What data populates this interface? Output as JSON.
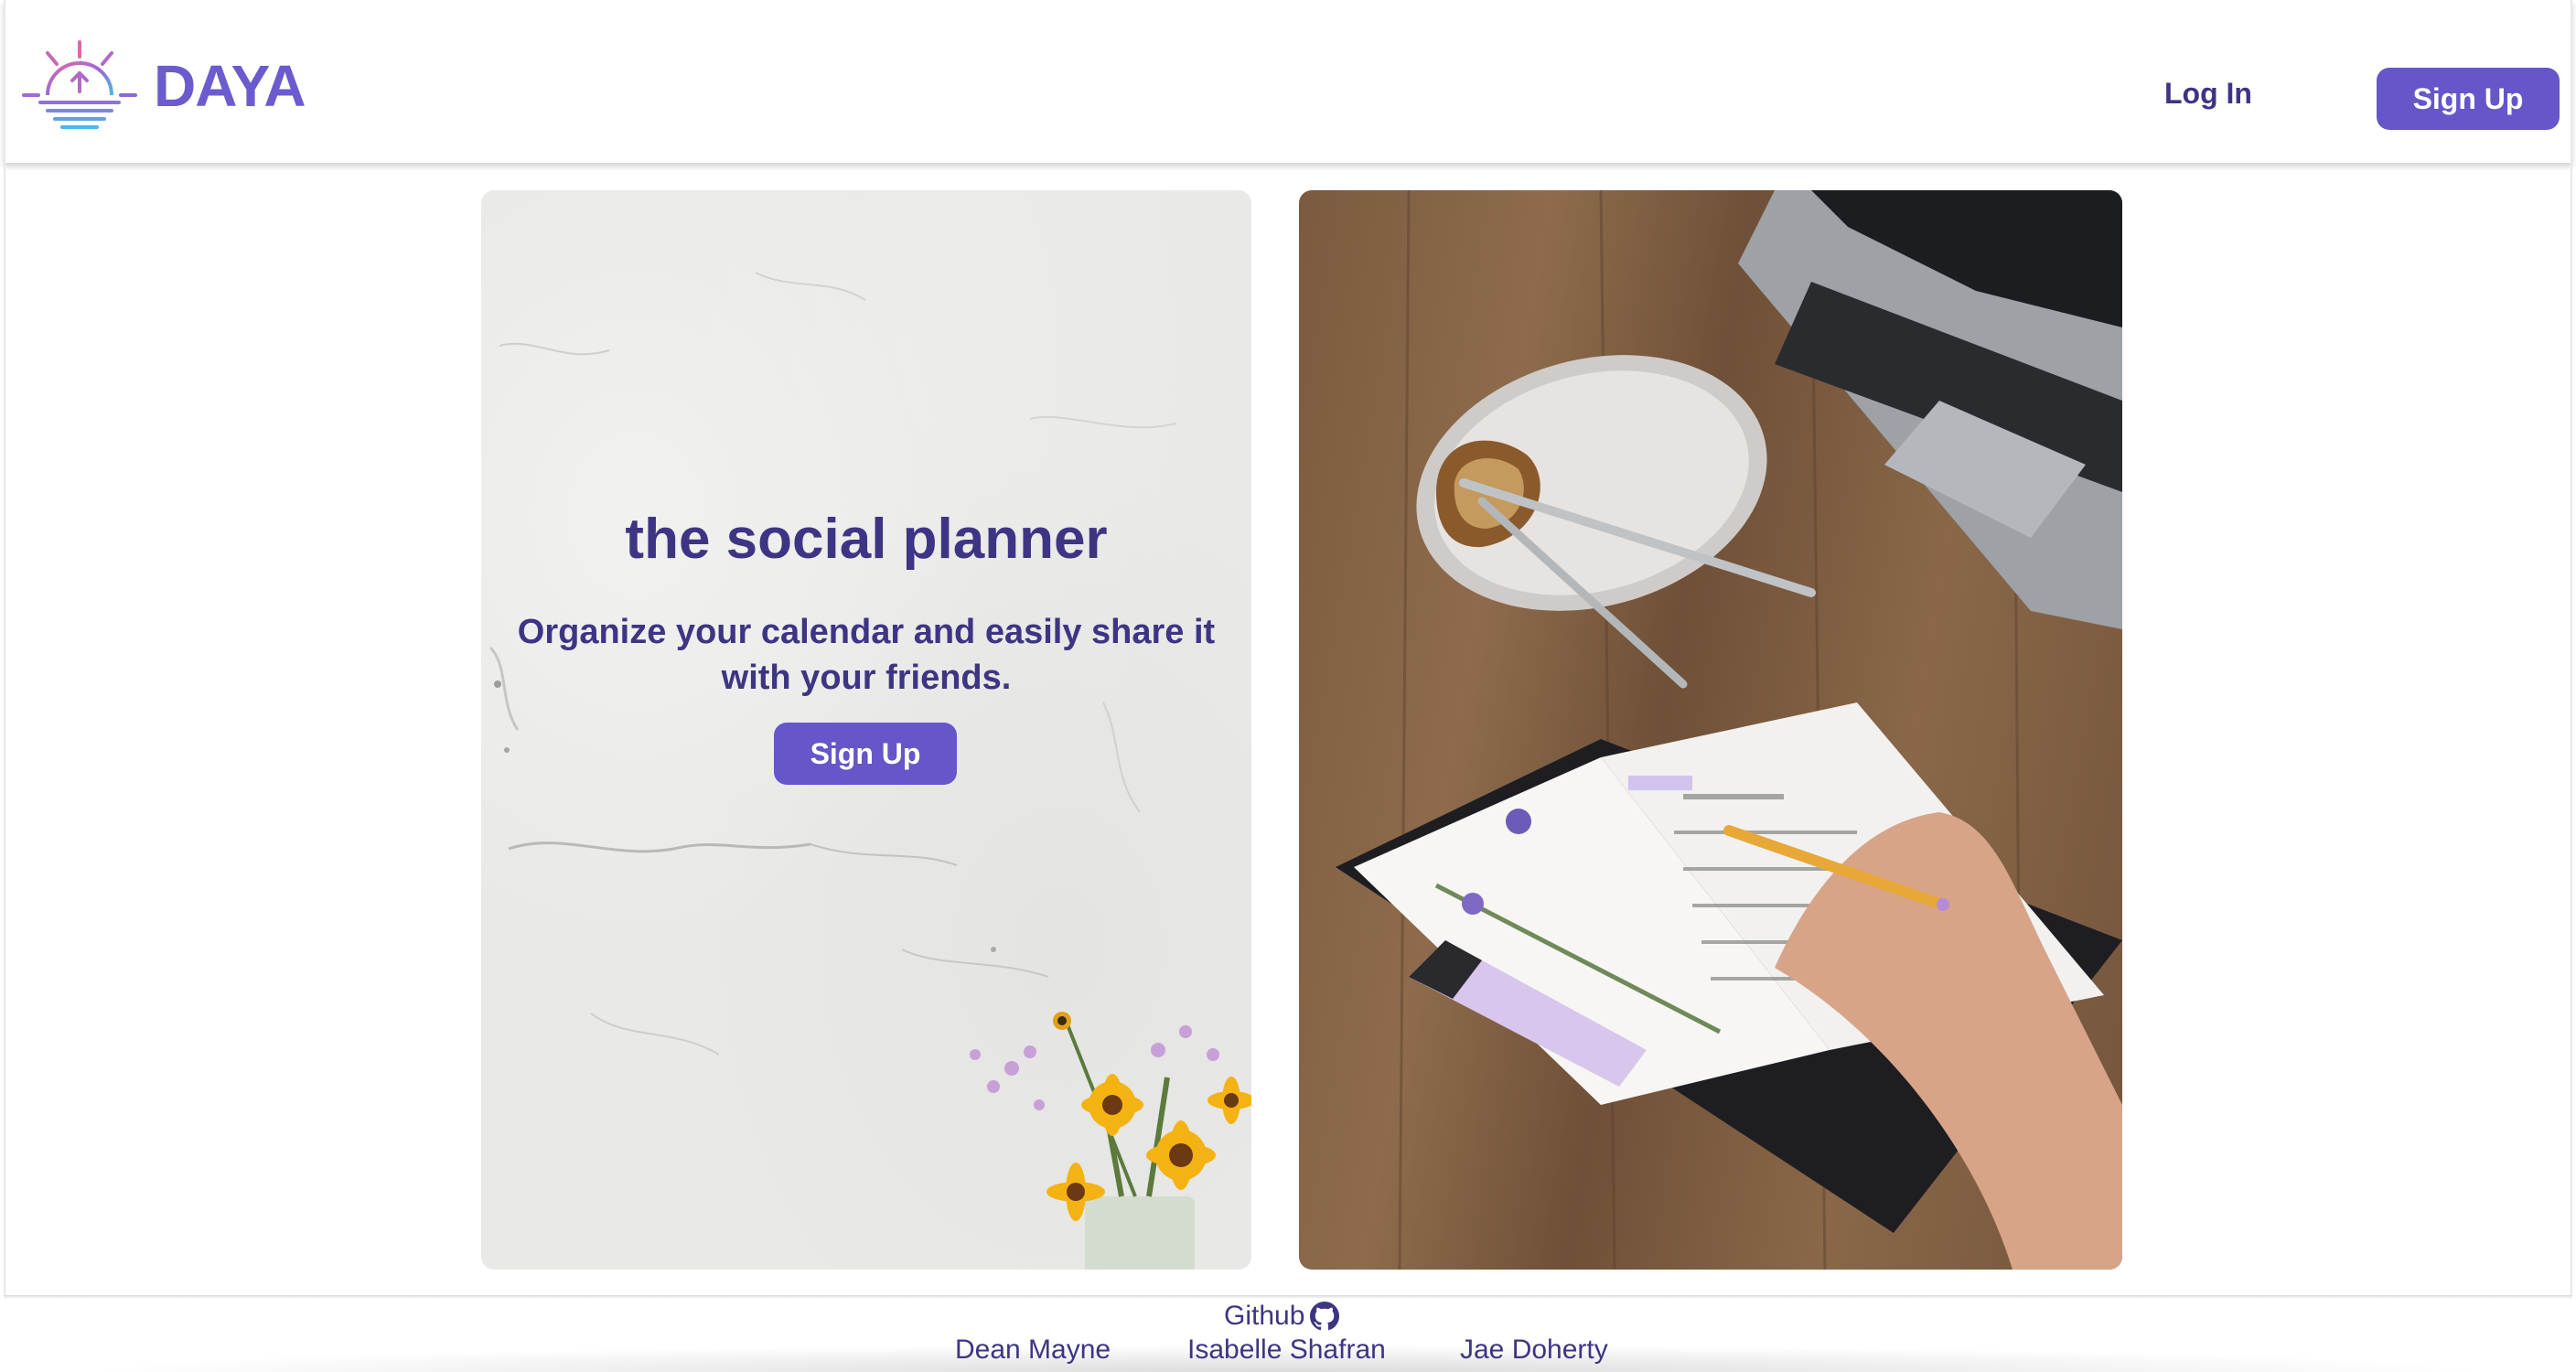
{
  "header": {
    "brand": "DAYA",
    "login_label": "Log In",
    "signup_label": "Sign Up"
  },
  "hero": {
    "title": "the social planner",
    "subtitle": "Organize your calendar and easily share it with your friends.",
    "cta_label": "Sign Up"
  },
  "footer": {
    "github_label": "Github",
    "authors": [
      "Dean Mayne",
      "Isabelle Shafran",
      "Jae Doherty"
    ]
  },
  "icons": {
    "logo": "sunrise-logo-icon",
    "github": "github-icon"
  },
  "colors": {
    "brand": "#6a5ccf",
    "primary": "#6556c9",
    "text_dark": "#3d3584"
  }
}
